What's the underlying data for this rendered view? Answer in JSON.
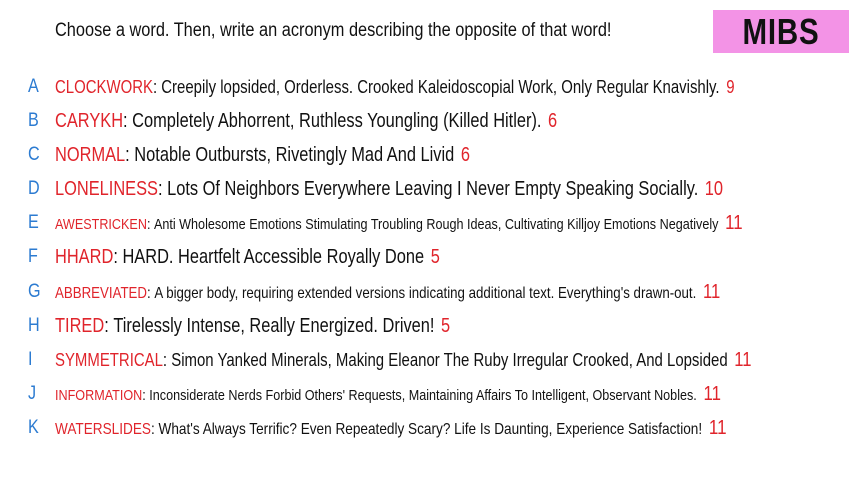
{
  "header": {
    "prompt": "Choose a word. Then, write an acronym describing the opposite of that word!",
    "badge": "MIBS"
  },
  "entries": [
    {
      "letter": "A",
      "word": "CLOCKWORK",
      "definition": "Creepily lopsided, Orderless. Crooked Kaleidoscopial Work, Only Regular Knavishly.",
      "count": "9"
    },
    {
      "letter": "B",
      "word": "CARYKH",
      "definition": "Completely Abhorrent, Ruthless Youngling (Killed Hitler).",
      "count": "6"
    },
    {
      "letter": "C",
      "word": "NORMAL",
      "definition": "Notable Outbursts, Rivetingly Mad And Livid",
      "count": "6"
    },
    {
      "letter": "D",
      "word": "LONELINESS",
      "definition": "Lots Of Neighbors Everywhere Leaving I Never Empty Speaking Socially.",
      "count": "10"
    },
    {
      "letter": "E",
      "word": "AWESTRICKEN",
      "definition": "Anti Wholesome Emotions Stimulating Troubling Rough Ideas, Cultivating Killjoy Emotions Negatively",
      "count": "11"
    },
    {
      "letter": "F",
      "word": "HHARD",
      "definition": "HARD. Heartfelt Accessible Royally Done",
      "count": "5"
    },
    {
      "letter": "G",
      "word": "ABBREVIATED",
      "definition": "A bigger body, requiring extended versions indicating additional text. Everything's drawn-out.",
      "count": "11"
    },
    {
      "letter": "H",
      "word": "TIRED",
      "definition": "Tirelessly Intense, Really Energized. Driven!",
      "count": "5"
    },
    {
      "letter": "I",
      "word": "SYMMETRICAL",
      "definition": "Simon Yanked Minerals, Making Eleanor The Ruby Irregular Crooked, And Lopsided",
      "count": "11"
    },
    {
      "letter": "J",
      "word": "INFORMATION",
      "definition": "Inconsiderate Nerds Forbid Others' Requests, Maintaining Affairs To Intelligent, Observant Nobles.",
      "count": "11"
    },
    {
      "letter": "K",
      "word": "WATERSLIDES",
      "definition": "What's Always Terrific? Even Repeatedly Scary? Life Is Daunting, Experience Satisfaction!",
      "count": "11"
    }
  ]
}
